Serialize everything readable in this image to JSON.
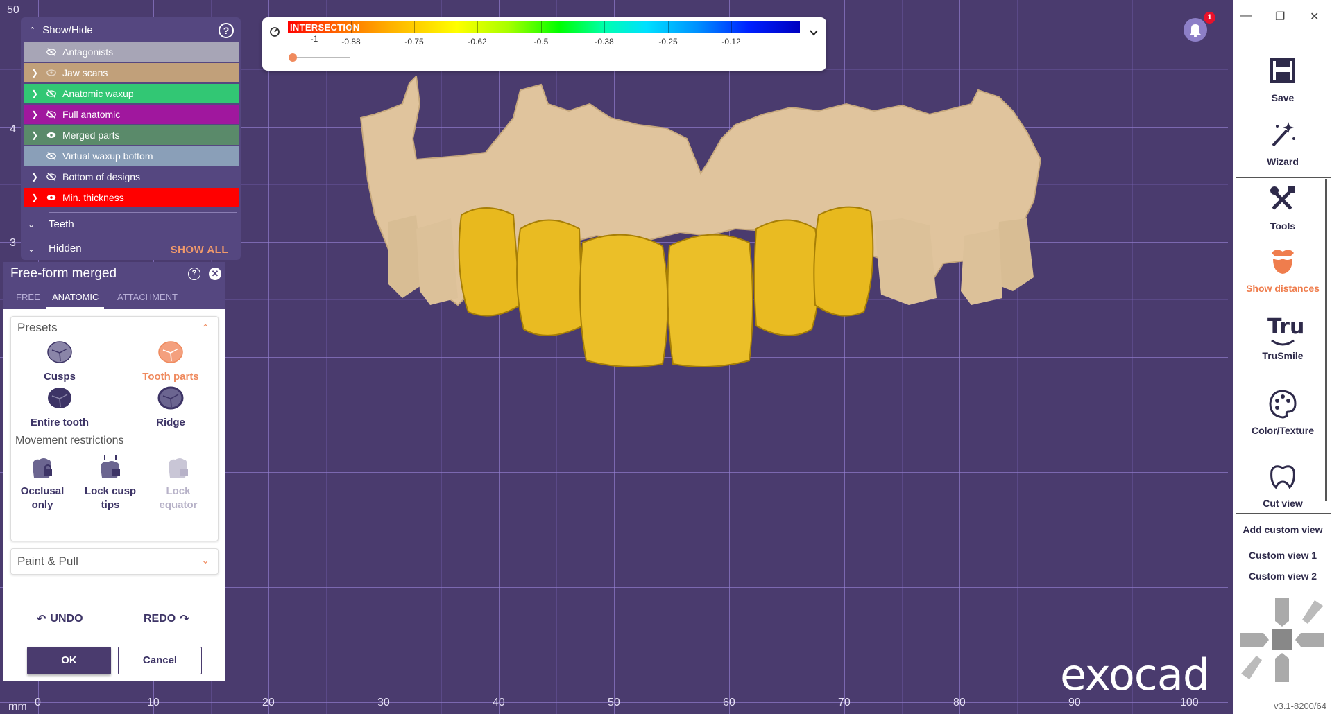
{
  "viewport": {
    "ruler_left": [
      "50",
      "4",
      "3"
    ],
    "ruler_bottom_unit": "mm",
    "ruler_bottom": [
      "0",
      "10",
      "20",
      "30",
      "40",
      "50",
      "60",
      "70",
      "80",
      "90",
      "100"
    ]
  },
  "scale": {
    "label": "INTERSECTION",
    "ticks": [
      "-1",
      "-0.88",
      "-0.75",
      "-0.62",
      "-0.5",
      "-0.38",
      "-0.25",
      "-0.12"
    ]
  },
  "notification": {
    "count": "1"
  },
  "showhide": {
    "title": "Show/Hide",
    "items": [
      {
        "label": "Antagonists",
        "color": "#a7a5b6",
        "has_arrow": false,
        "icon": "eye-off-icon"
      },
      {
        "label": "Jaw scans",
        "color": "#c1a07a",
        "has_arrow": true,
        "icon": "eye-faded-icon"
      },
      {
        "label": "Anatomic waxup",
        "color": "#32c774",
        "has_arrow": true,
        "icon": "eye-off-icon"
      },
      {
        "label": "Full anatomic",
        "color": "#a0179e",
        "has_arrow": true,
        "icon": "eye-off-icon"
      },
      {
        "label": "Merged parts",
        "color": "#5a8a6a",
        "has_arrow": true,
        "icon": "eye-icon"
      },
      {
        "label": "Virtual waxup bottom",
        "color": "#8a9fb8",
        "has_arrow": false,
        "icon": "eye-off-icon"
      },
      {
        "label": "Bottom of designs",
        "color": "#554780",
        "has_arrow": true,
        "icon": "eye-off-icon"
      },
      {
        "label": "Min. thickness",
        "color": "#ff0000",
        "has_arrow": true,
        "icon": "eye-icon"
      }
    ],
    "teeth": "Teeth",
    "hidden": "Hidden",
    "show_all": "SHOW ALL"
  },
  "freeform": {
    "title": "Free-form merged",
    "tabs": [
      "FREE",
      "ANATOMIC",
      "ATTACHMENT"
    ],
    "presets_title": "Presets",
    "presets": [
      "Cusps",
      "Tooth parts",
      "Entire tooth",
      "Ridge"
    ],
    "movement_title": "Movement restrictions",
    "movement": [
      {
        "line1": "Occlusal",
        "line2": "only"
      },
      {
        "line1": "Lock cusp",
        "line2": "tips"
      },
      {
        "line1": "Lock",
        "line2": "equator"
      }
    ],
    "paint_title": "Paint & Pull",
    "undo": "UNDO",
    "redo": "REDO",
    "ok": "OK",
    "cancel": "Cancel"
  },
  "logo": "exocad",
  "sidebar": {
    "items": [
      "Save",
      "Wizard",
      "Tools",
      "Show distances",
      "TruSmile",
      "Color/Texture",
      "Cut view"
    ],
    "trusmile_glyph": "Tru",
    "add_custom_view": "Add custom view",
    "custom_views": [
      "Custom view 1",
      "Custom view 2"
    ],
    "version": "v3.1-8200/64"
  },
  "colors": {
    "background": "#4a3b6e",
    "panel": "#554780",
    "accent": "#ef8a5e",
    "tooth": "#e8b91e",
    "gingiva": "#e0c49d"
  }
}
